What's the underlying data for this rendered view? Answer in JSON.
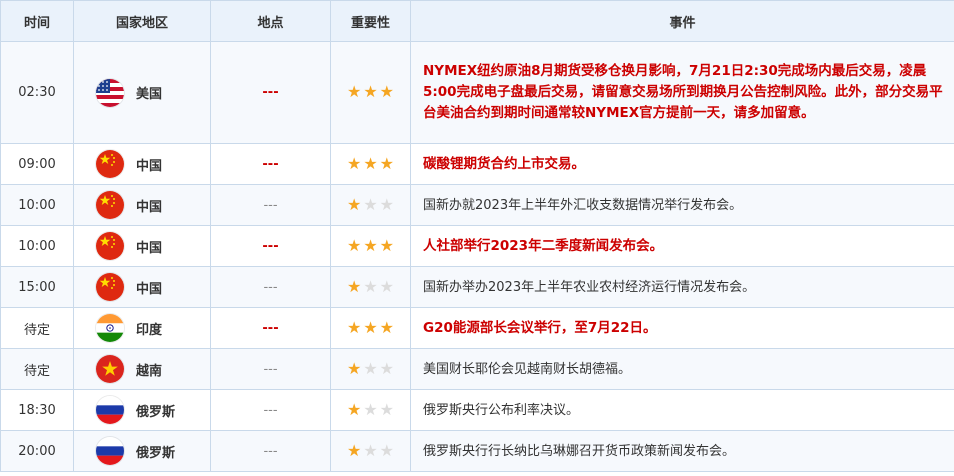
{
  "header": {
    "time": "时间",
    "country": "国家地区",
    "location": "地点",
    "importance": "重要性",
    "event": "事件"
  },
  "rows": [
    {
      "time": "02:30",
      "country": "美国",
      "flag": "us-flag-icon",
      "location": "---",
      "stars": 3,
      "highlight": true,
      "event": "NYMEX纽约原油8月期货受移仓换月影响，7月21日2:30完成场内最后交易，凌晨5:00完成电子盘最后交易，请留意交易场所到期换月公告控制风险。此外，部分交易平台美油合约到期时间通常较NYMEX官方提前一天，请多加留意。"
    },
    {
      "time": "09:00",
      "country": "中国",
      "flag": "china-flag-icon",
      "location": "---",
      "stars": 3,
      "highlight": true,
      "event": "碳酸锂期货合约上市交易。"
    },
    {
      "time": "10:00",
      "country": "中国",
      "flag": "china-flag-icon",
      "location": "---",
      "stars": 1,
      "highlight": false,
      "event": "国新办就2023年上半年外汇收支数据情况举行发布会。"
    },
    {
      "time": "10:00",
      "country": "中国",
      "flag": "china-flag-icon",
      "location": "---",
      "stars": 3,
      "highlight": true,
      "event": "人社部举行2023年二季度新闻发布会。"
    },
    {
      "time": "15:00",
      "country": "中国",
      "flag": "china-flag-icon",
      "location": "---",
      "stars": 1,
      "highlight": false,
      "event": "国新办举办2023年上半年农业农村经济运行情况发布会。"
    },
    {
      "time": "待定",
      "country": "印度",
      "flag": "india-flag-icon",
      "location": "---",
      "stars": 3,
      "highlight": true,
      "event": "G20能源部长会议举行，至7月22日。"
    },
    {
      "time": "待定",
      "country": "越南",
      "flag": "vietnam-flag-icon",
      "location": "---",
      "stars": 1,
      "highlight": false,
      "event": "美国财长耶伦会见越南财长胡德福。"
    },
    {
      "time": "18:30",
      "country": "俄罗斯",
      "flag": "russia-flag-icon",
      "location": "---",
      "stars": 1,
      "highlight": false,
      "event": "俄罗斯央行公布利率决议。"
    },
    {
      "time": "20:00",
      "country": "俄罗斯",
      "flag": "russia-flag-icon",
      "location": "---",
      "stars": 1,
      "highlight": false,
      "event": "俄罗斯央行行长纳比乌琳娜召开货币政策新闻发布会。"
    }
  ],
  "colors": {
    "highlight": "#cc0000",
    "star_on": "#f5a623",
    "star_off": "#dcdcdc",
    "header_bg": "#eaf2fb",
    "border": "#c9d9ea"
  }
}
